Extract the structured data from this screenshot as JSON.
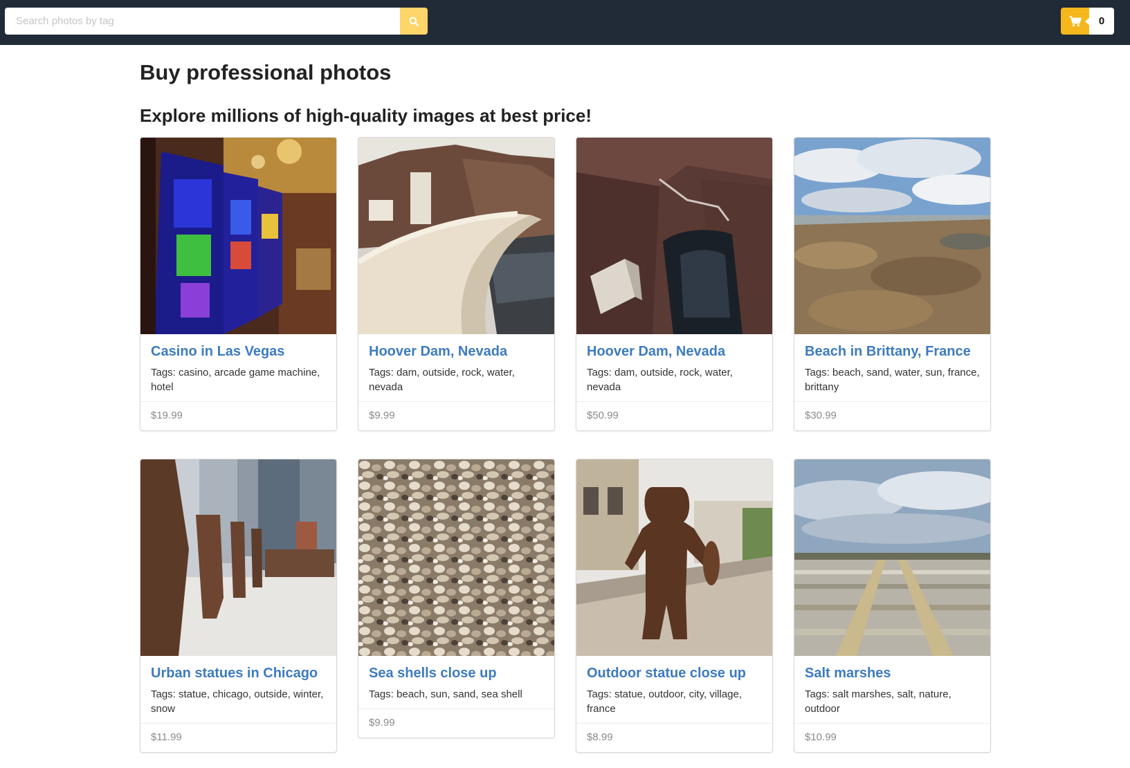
{
  "header": {
    "search_placeholder": "Search photos by tag",
    "search_icon": "search-icon",
    "cart_icon": "shopping-cart-icon",
    "cart_count": "0",
    "colors": {
      "topbar": "#212a37",
      "search_button": "#ffd56a",
      "cart_icon_bg": "#f5b71c"
    }
  },
  "main": {
    "title": "Buy professional photos",
    "subtitle": "Explore millions of high-quality images at best price!",
    "link_color": "#3d7bbf"
  },
  "photos": [
    {
      "title": "Casino in Las Vegas",
      "tags": "Tags: casino, arcade game machine, hotel",
      "price": "$19.99",
      "image": "casino-slot-machines"
    },
    {
      "title": "Hoover Dam, Nevada",
      "tags": "Tags: dam, outside, rock, water, nevada",
      "price": "$9.99",
      "image": "hoover-dam-wall"
    },
    {
      "title": "Hoover Dam, Nevada",
      "tags": "Tags: dam, outside, rock, water, nevada",
      "price": "$50.99",
      "image": "hoover-dam-canyon"
    },
    {
      "title": "Beach in Brittany, France",
      "tags": "Tags: beach, sand, water, sun, france, brittany",
      "price": "$30.99",
      "image": "rocky-beach"
    },
    {
      "title": "Urban statues in Chicago",
      "tags": "Tags: statue, chicago, outside, winter, snow",
      "price": "$11.99",
      "image": "headless-statues"
    },
    {
      "title": "Sea shells close up",
      "tags": "Tags: beach, sun, sand, sea shell",
      "price": "$9.99",
      "image": "sea-shells"
    },
    {
      "title": "Outdoor statue close up",
      "tags": "Tags: statue, outdoor, city, village, france",
      "price": "$8.99",
      "image": "bronze-statue"
    },
    {
      "title": "Salt marshes",
      "tags": "Tags: salt marshes, salt, nature, outdoor",
      "price": "$10.99",
      "image": "salt-marshes"
    }
  ]
}
